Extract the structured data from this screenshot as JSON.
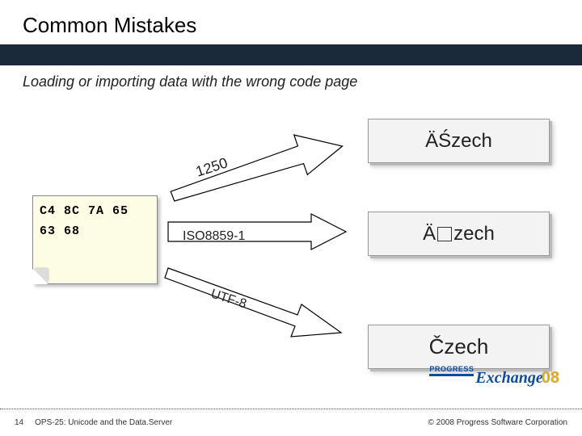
{
  "title": "Common Mistakes",
  "subtitle": "Loading or importing data with the wrong code page",
  "bytes": {
    "line1": "C4 8C 7A 65",
    "line2": "63 68"
  },
  "encodings": {
    "cp1250_label": "1250",
    "iso_label": "ISO8859-1",
    "utf8_label": "UTF-8"
  },
  "results": {
    "cp1250": "ÄŚzech",
    "iso_prefix": "Ä",
    "iso_suffix": "zech",
    "utf8": "Čzech"
  },
  "footer": {
    "page": "14",
    "session": "OPS-25: Unicode and the Data.Server",
    "copyright": "© 2008 Progress Software Corporation"
  },
  "logo": {
    "brand": "PROGRESS",
    "product": "Exchange",
    "year": "08"
  }
}
